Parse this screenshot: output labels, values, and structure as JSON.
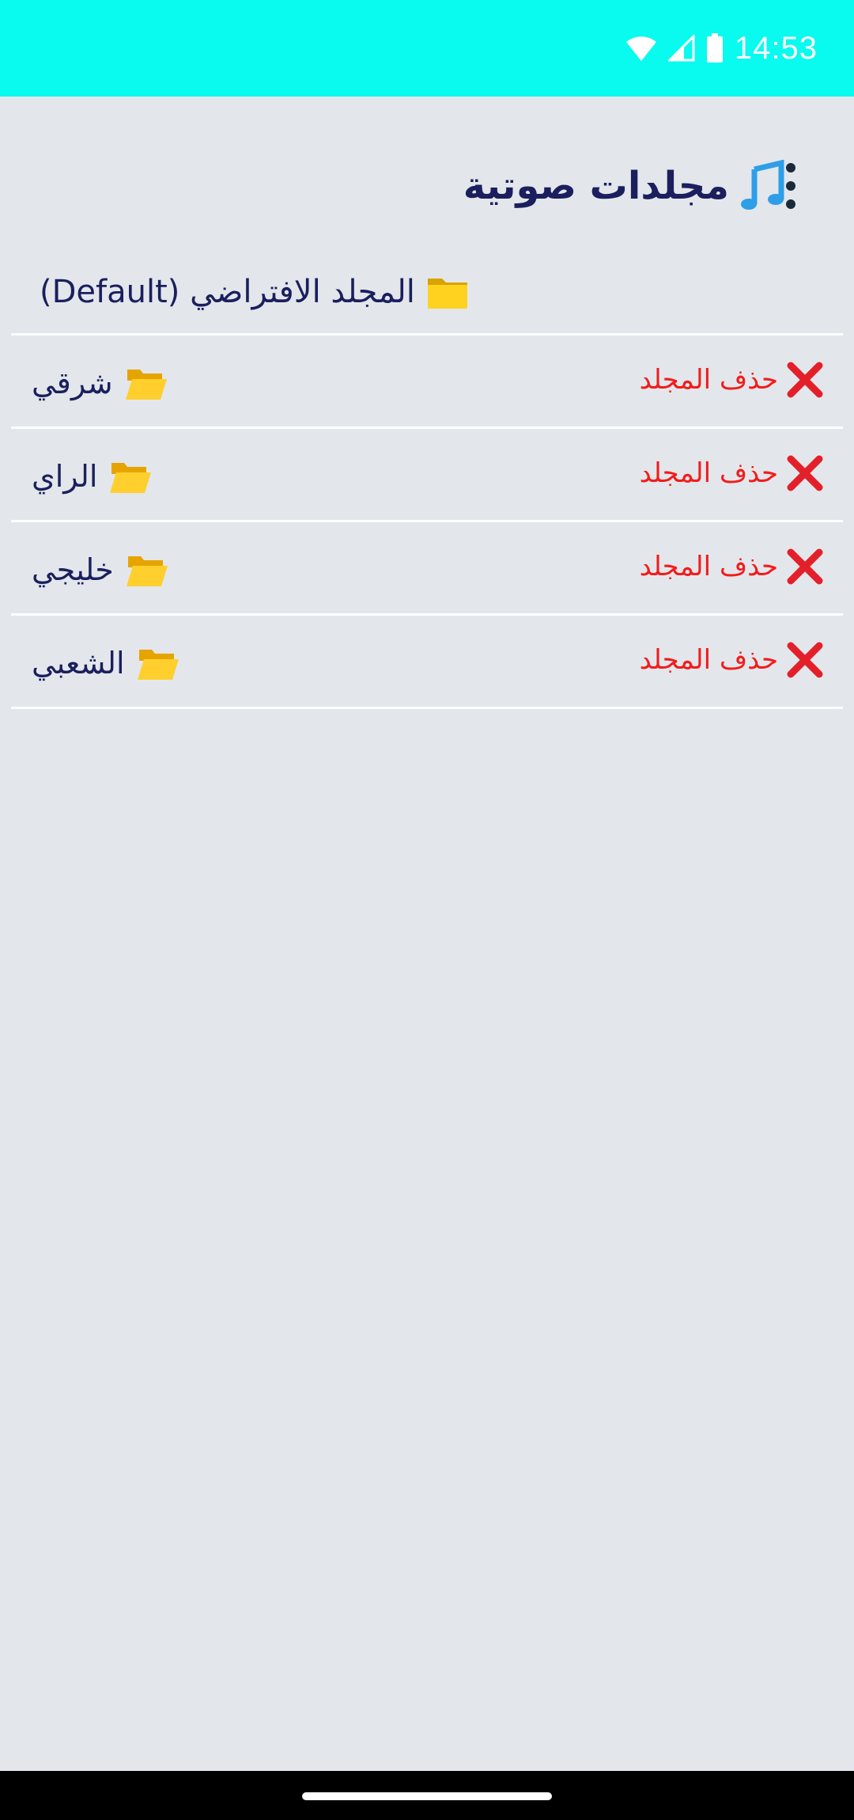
{
  "status_bar": {
    "time": "14:53",
    "icons": [
      "wifi-icon",
      "signal-icon",
      "battery-icon"
    ],
    "background": "#08fbee"
  },
  "header": {
    "title": "مجلدات صوتية",
    "icon": "music-note-icon"
  },
  "default_folder": {
    "label": "المجلد الافتراضي (Default)",
    "icon": "folder-icon"
  },
  "folders": [
    {
      "name": "شرقي",
      "icon": "open-folder-icon",
      "delete_label": "حذف المجلد",
      "delete_icon": "cross-mark-icon"
    },
    {
      "name": "الراي",
      "icon": "open-folder-icon",
      "delete_label": "حذف المجلد",
      "delete_icon": "cross-mark-icon"
    },
    {
      "name": "خليجي",
      "icon": "open-folder-icon",
      "delete_label": "حذف المجلد",
      "delete_icon": "cross-mark-icon"
    },
    {
      "name": "الشعبي",
      "icon": "open-folder-icon",
      "delete_label": "حذف المجلد",
      "delete_icon": "cross-mark-icon"
    }
  ],
  "colors": {
    "accent": "#08fbee",
    "text": "#1b1f5e",
    "danger": "#f21c1c",
    "background": "#e3e7eb"
  }
}
